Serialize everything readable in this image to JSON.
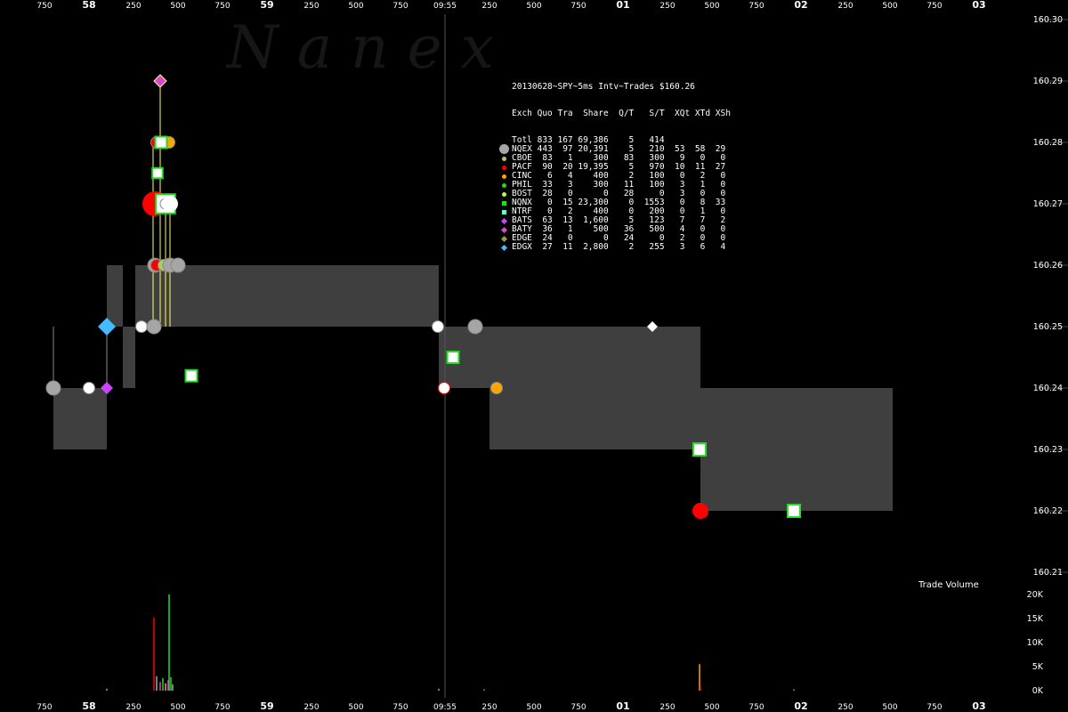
{
  "watermark": "N a n e x",
  "chart_data": {
    "type": "line",
    "title": "20130628~SPY~5ms Intv~Trades $160.26",
    "time_axis": {
      "ticks": [
        "750",
        "58",
        "250",
        "500",
        "750",
        "59",
        "250",
        "500",
        "750",
        "09:55",
        "250",
        "500",
        "750",
        "01",
        "250",
        "500",
        "750",
        "02",
        "250",
        "500",
        "750",
        "03"
      ],
      "major": [
        "58",
        "59",
        "01",
        "02",
        "03"
      ]
    },
    "price_axis": {
      "ticks": [
        "160.30",
        "160.29",
        "160.28",
        "160.27",
        "160.26",
        "160.25",
        "160.24",
        "160.23",
        "160.22",
        "160.21"
      ]
    },
    "volume_axis": {
      "title": "Trade Volume",
      "ticks": [
        "20K",
        "15K",
        "10K",
        "5K",
        "0K"
      ]
    },
    "nbbo_segments": [
      {
        "t0": -0.2,
        "t1": 0.1,
        "bid": 160.23,
        "ask": 160.24
      },
      {
        "t0": 0.1,
        "t1": 0.19,
        "bid": 160.25,
        "ask": 160.26
      },
      {
        "t0": 0.19,
        "t1": 0.26,
        "bid": 160.24,
        "ask": 160.25
      },
      {
        "t0": 0.26,
        "t1": 1.965,
        "bid": 160.25,
        "ask": 160.26
      },
      {
        "t0": 1.965,
        "t1": 2.25,
        "bid": 160.24,
        "ask": 160.25
      },
      {
        "t0": 2.25,
        "t1": 3.435,
        "bid": 160.23,
        "ask": 160.25
      },
      {
        "t0": 3.435,
        "t1": 4.515,
        "bid": 160.22,
        "ask": 160.24
      }
    ],
    "quotes": [
      {
        "t": -0.2,
        "p": 160.24,
        "exch": "NQEX"
      },
      {
        "t": 0.0,
        "p": 160.24,
        "exch": "PHIL_W"
      },
      {
        "t": 0.1,
        "p": 160.24,
        "exch": "BATS"
      },
      {
        "t": 0.1,
        "p": 160.25,
        "exch": "EDGX"
      },
      {
        "t": 0.295,
        "p": 160.25,
        "exch": "PHIL_W"
      },
      {
        "t": 0.365,
        "p": 160.25,
        "exch": "NQEX"
      },
      {
        "t": 0.37,
        "p": 160.26,
        "exch": "NQEX"
      },
      {
        "t": 0.38,
        "p": 160.26,
        "exch": "PACF"
      },
      {
        "t": 0.42,
        "p": 160.26,
        "exch": "CBOE"
      },
      {
        "t": 0.455,
        "p": 160.26,
        "exch": "NQEX"
      },
      {
        "t": 0.5,
        "p": 160.26,
        "exch": "NQEX"
      },
      {
        "t": 0.38,
        "p": 160.28,
        "exch": "PACF"
      },
      {
        "t": 0.45,
        "p": 160.28,
        "exch": "CINC"
      },
      {
        "t": 1.96,
        "p": 160.25,
        "exch": "PHIL_W"
      },
      {
        "t": 2.17,
        "p": 160.25,
        "exch": "NQEX"
      },
      {
        "t": 1.995,
        "p": 160.24,
        "exch": "PACF_W"
      },
      {
        "t": 2.29,
        "p": 160.24,
        "exch": "CINC"
      }
    ],
    "trades": [
      {
        "t": 0.4,
        "p": 160.29,
        "exch": "BATY",
        "size": 20
      },
      {
        "t": 0.405,
        "p": 160.28,
        "exch": "NQNX",
        "size": 200
      },
      {
        "t": 0.385,
        "p": 160.275,
        "exch": "NQNX",
        "size": 100
      },
      {
        "t": 0.37,
        "p": 160.27,
        "exch": "PACF",
        "size": 2900
      },
      {
        "t": 0.43,
        "p": 160.27,
        "exch": "NQNX",
        "size": 1500
      },
      {
        "t": 0.455,
        "p": 160.27,
        "exch": "PHIL_W",
        "size": 20
      },
      {
        "t": 0.575,
        "p": 160.242,
        "exch": "NQNX",
        "size": 200
      },
      {
        "t": 2.045,
        "p": 160.245,
        "exch": "NTRF",
        "size": 200
      },
      {
        "t": 3.165,
        "p": 160.25,
        "exch": "NTRF_D",
        "size": 20
      },
      {
        "t": 3.43,
        "p": 160.23,
        "exch": "NQNX",
        "size": 300
      },
      {
        "t": 3.435,
        "p": 160.22,
        "exch": "PACF",
        "size": 900
      },
      {
        "t": 3.96,
        "p": 160.22,
        "exch": "NQNX",
        "size": 300
      }
    ],
    "spikes": [
      {
        "t": 0.4,
        "p0": 160.25,
        "p1": 160.29
      },
      {
        "t": 0.36,
        "p0": 160.25,
        "p1": 160.28
      },
      {
        "t": 0.455,
        "p0": 160.25,
        "p1": 160.27
      },
      {
        "t": 0.43,
        "p0": 160.25,
        "p1": 160.27
      },
      {
        "t": -0.2,
        "p0": 160.24,
        "p1": 160.25
      },
      {
        "t": 0.1,
        "p0": 160.24,
        "p1": 160.25
      }
    ],
    "volume": [
      {
        "t": 0.1,
        "v": 400,
        "exch": "EDGX"
      },
      {
        "t": 0.365,
        "v": 15200,
        "exch": "PACF"
      },
      {
        "t": 0.38,
        "v": 3000,
        "exch": "NQEX"
      },
      {
        "t": 0.4,
        "v": 1800,
        "exch": "BATY"
      },
      {
        "t": 0.415,
        "v": 2600,
        "exch": "NQNX"
      },
      {
        "t": 0.43,
        "v": 1500,
        "exch": "CINC"
      },
      {
        "t": 0.445,
        "v": 2200,
        "exch": "BATS"
      },
      {
        "t": 0.45,
        "v": 20000,
        "exch": "NQNX"
      },
      {
        "t": 0.46,
        "v": 2800,
        "exch": "PHIL"
      },
      {
        "t": 0.47,
        "v": 1300,
        "exch": "NQEX"
      },
      {
        "t": 1.965,
        "v": 400,
        "exch": "NQEX"
      },
      {
        "t": 2.22,
        "v": 300,
        "exch": "PHIL"
      },
      {
        "t": 3.43,
        "v": 5500,
        "exch": "CINC"
      },
      {
        "t": 3.435,
        "v": 900,
        "exch": "PACF"
      },
      {
        "t": 3.96,
        "v": 300,
        "exch": "NQNX"
      }
    ],
    "legend": {
      "header": "Exch Quo Tra  Share  Q/T   S/T  XQt XTd XSh",
      "rows": [
        {
          "exch": "Totl",
          "cols": " 833 167 69,386    5   414",
          "color": "",
          "shape": "none"
        },
        {
          "exch": "NQEX",
          "cols": " 443  97 20,391    5   210  53  58  29",
          "color": "#a6a6a6",
          "shape": "circle-big"
        },
        {
          "exch": "CBOE",
          "cols": "  83   1    300   83   300   9   0   0",
          "color": "#a8cc66",
          "shape": "circle"
        },
        {
          "exch": "PACF",
          "cols": "  90  20 19,395    5   970  10  11  27",
          "color": "#ff0000",
          "shape": "circle"
        },
        {
          "exch": "CINC",
          "cols": "   6   4    400    2   100   0   2   0",
          "color": "#ffa500",
          "shape": "circle"
        },
        {
          "exch": "PHIL",
          "cols": "  33   3    300   11   100   3   1   0",
          "color": "#33cc33",
          "shape": "circle"
        },
        {
          "exch": "BOST",
          "cols": "  28   0      0   28     0   3   0   0",
          "color": "#ccee44",
          "shape": "circle"
        },
        {
          "exch": "NQNX",
          "cols": "   0  15 23,300    0  1553   0   8  33",
          "color": "#22dd22",
          "shape": "square"
        },
        {
          "exch": "NTRF",
          "cols": "   0   2    400    0   200   0   1   0",
          "color": "#66ffcc",
          "shape": "square"
        },
        {
          "exch": "BATS",
          "cols": "  63  13  1,600    5   123   7   7   2",
          "color": "#cc44ff",
          "shape": "diamond"
        },
        {
          "exch": "BATY",
          "cols": "  36   1    500   36   500   4   0   0",
          "color": "#dd44cc",
          "shape": "diamond"
        },
        {
          "exch": "EDGE",
          "cols": "  24   0      0   24     0   2   0   0",
          "color": "#999944",
          "shape": "diamond"
        },
        {
          "exch": "EDGX",
          "cols": "  27  11  2,800    2   255   3   6   4",
          "color": "#44bbff",
          "shape": "diamond"
        }
      ]
    }
  }
}
